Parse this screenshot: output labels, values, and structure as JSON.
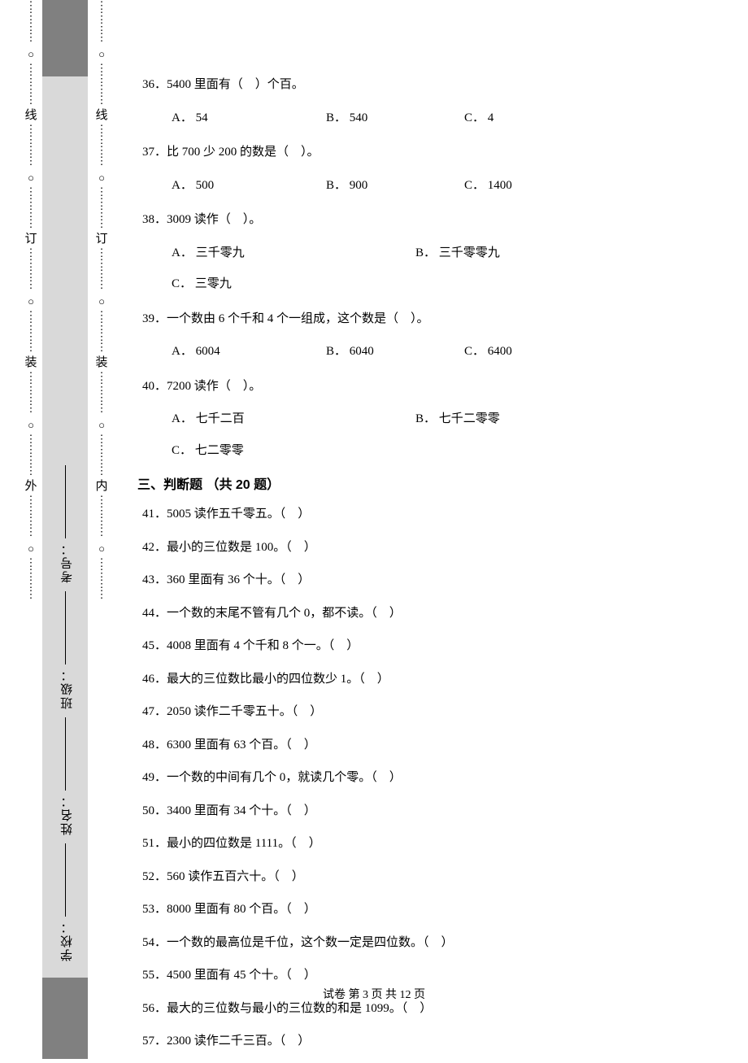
{
  "binding": {
    "outer_chars": [
      "外"
    ],
    "inner_chars": [
      "内"
    ],
    "markers": [
      "装",
      "订",
      "线"
    ],
    "field_labels": [
      "学校：",
      "姓名：",
      "班级：",
      "考号："
    ]
  },
  "questions": [
    {
      "num": "36",
      "text": "5400 里面有（　）个百。",
      "opts": [
        {
          "k": "A",
          "v": "54"
        },
        {
          "k": "B",
          "v": "540"
        },
        {
          "k": "C",
          "v": "4"
        }
      ],
      "layout": "3col"
    },
    {
      "num": "37",
      "text": "比 700 少 200 的数是（　）。",
      "opts": [
        {
          "k": "A",
          "v": "500"
        },
        {
          "k": "B",
          "v": "900"
        },
        {
          "k": "C",
          "v": "1400"
        }
      ],
      "layout": "3col"
    },
    {
      "num": "38",
      "text": "3009 读作（　）。",
      "opts": [
        {
          "k": "A",
          "v": "三千零九"
        },
        {
          "k": "B",
          "v": "三千零零九"
        },
        {
          "k": "C",
          "v": "三零九"
        }
      ],
      "layout": "2+1"
    },
    {
      "num": "39",
      "text": "一个数由 6 个千和 4 个一组成，这个数是（　）。",
      "opts": [
        {
          "k": "A",
          "v": "6004"
        },
        {
          "k": "B",
          "v": "6040"
        },
        {
          "k": "C",
          "v": "6400"
        }
      ],
      "layout": "3col"
    },
    {
      "num": "40",
      "text": "7200 读作（　）。",
      "opts": [
        {
          "k": "A",
          "v": "七千二百"
        },
        {
          "k": "B",
          "v": "七千二零零"
        },
        {
          "k": "C",
          "v": "七二零零"
        }
      ],
      "layout": "2+1"
    }
  ],
  "section3": {
    "heading": "三、判断题 （共 20 题）",
    "items": [
      {
        "num": "41",
        "text": "5005 读作五千零五。（　）"
      },
      {
        "num": "42",
        "text": "最小的三位数是 100。（　）"
      },
      {
        "num": "43",
        "text": "360 里面有 36 个十。（　）"
      },
      {
        "num": "44",
        "text": "一个数的末尾不管有几个 0，都不读。（　）"
      },
      {
        "num": "45",
        "text": "4008 里面有 4 个千和 8 个一。（　）"
      },
      {
        "num": "46",
        "text": "最大的三位数比最小的四位数少 1。（　）"
      },
      {
        "num": "47",
        "text": "2050 读作二千零五十。（　）"
      },
      {
        "num": "48",
        "text": "6300 里面有 63 个百。（　）"
      },
      {
        "num": "49",
        "text": "一个数的中间有几个 0，就读几个零。（　）"
      },
      {
        "num": "50",
        "text": "3400 里面有 34 个十。（　）"
      },
      {
        "num": "51",
        "text": "最小的四位数是 1111。（　）"
      },
      {
        "num": "52",
        "text": "560 读作五百六十。（　）"
      },
      {
        "num": "53",
        "text": "8000 里面有 80 个百。（　）"
      },
      {
        "num": "54",
        "text": "一个数的最高位是千位，这个数一定是四位数。（　）"
      },
      {
        "num": "55",
        "text": "4500 里面有 45 个十。（　）"
      },
      {
        "num": "56",
        "text": "最大的三位数与最小的三位数的和是 1099。（　）"
      },
      {
        "num": "57",
        "text": "2300 读作二千三百。（　）"
      }
    ]
  },
  "footer": "试卷 第 3 页 共 12 页"
}
